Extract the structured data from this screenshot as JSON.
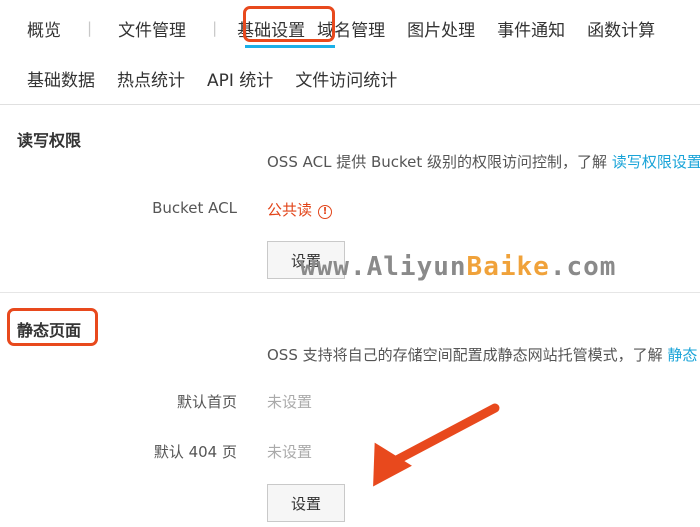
{
  "nav": {
    "row1": [
      "概览",
      "文件管理",
      "基础设置",
      "域名管理",
      "图片处理",
      "事件通知",
      "函数计算"
    ],
    "row2": [
      "基础数据",
      "热点统计",
      "API 统计",
      "文件访问统计"
    ],
    "active_tab": "基础设置",
    "separator": "|"
  },
  "rw_section": {
    "title": "读写权限",
    "description": "OSS ACL 提供 Bucket 级别的权限访问控制，了解",
    "description_link": "读写权限设置",
    "acl_label": "Bucket ACL",
    "acl_value": "公共读",
    "warn_icon": "!",
    "button": "设置"
  },
  "static_section": {
    "title": "静态页面",
    "description": "OSS 支持将自己的存储空间配置成静态网站托管模式，了解",
    "description_link": "静态",
    "index_label": "默认首页",
    "index_value": "未设置",
    "error_label": "默认 404 页",
    "error_value": "未设置",
    "button": "设置"
  },
  "watermark": {
    "part1": "www.Aliyun",
    "part2": "Baike",
    "part3": ".com"
  },
  "colors": {
    "highlight": "#e8491d",
    "link": "#1aa4d8",
    "active_underline": "#1ab0e8",
    "warning": "#e2451a"
  }
}
